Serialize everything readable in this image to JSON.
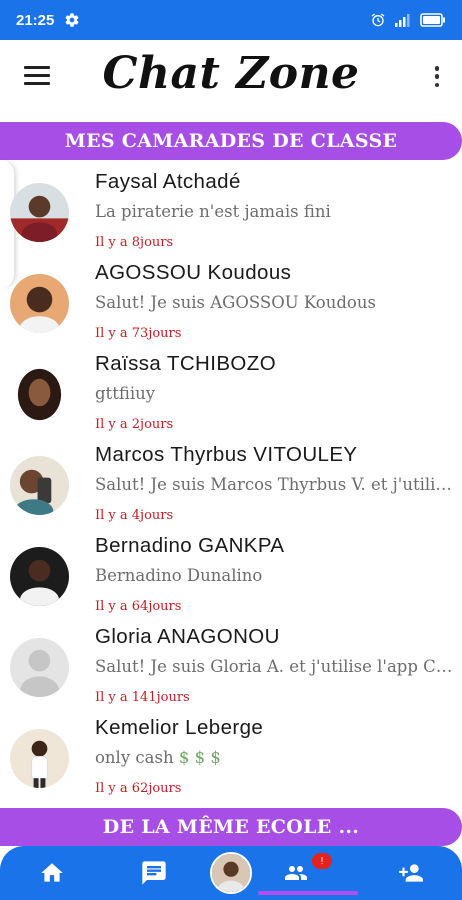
{
  "status_bar": {
    "time": "21:25",
    "icons": [
      "gear-icon",
      "alarm-icon",
      "signal-icon",
      "battery-icon"
    ]
  },
  "app_bar": {
    "title": "Chat Zone",
    "menu_icon": "menu-icon",
    "more_icon": "more-vertical-icon"
  },
  "sections": {
    "classmates_title": "MES CAMARADES DE CLASSE",
    "same_school_title": "DE LA MÊME ECOLE ..."
  },
  "contacts": [
    {
      "name": "Faysal Atchadé",
      "message": "La piraterie n'est jamais fini",
      "time": "Il y a 8jours"
    },
    {
      "name": "AGOSSOU Koudous",
      "message": "Salut! Je suis AGOSSOU Koudous",
      "time": "Il y a 73jours"
    },
    {
      "name": "Raïssa TCHIBOZO",
      "message": "gttfiiuy",
      "time": "Il y a 2jours"
    },
    {
      "name": "Marcos Thyrbus VITOULEY",
      "message": "Salut! Je suis Marcos Thyrbus V. et j'utilise l'app Chat Zone",
      "time": "Il y a 4jours"
    },
    {
      "name": "Bernadino GANKPA",
      "message": " Bernadino Dunalino",
      "time": "Il y a 64jours"
    },
    {
      "name": "Gloria ANAGONOU",
      "message": "Salut! Je suis Gloria A. et j'utilise l'app Chat Zone",
      "time": "Il y a 141jours"
    },
    {
      "name": "Kemelior Leberge",
      "message": "only cash",
      "message_suffix": "$ $ $",
      "time": "Il y a 62jours"
    }
  ],
  "bottom_nav": {
    "items": [
      "home-icon",
      "chat-icon",
      "profile-avatar",
      "friends-icon",
      "add-friend-icon"
    ],
    "friends_badge": "!",
    "active_item": "friends-icon"
  },
  "colors": {
    "primary_blue": "#1a73e8",
    "banner_purple": "#a64ee6",
    "time_red": "#c01f24",
    "badge_red": "#e5221d"
  }
}
